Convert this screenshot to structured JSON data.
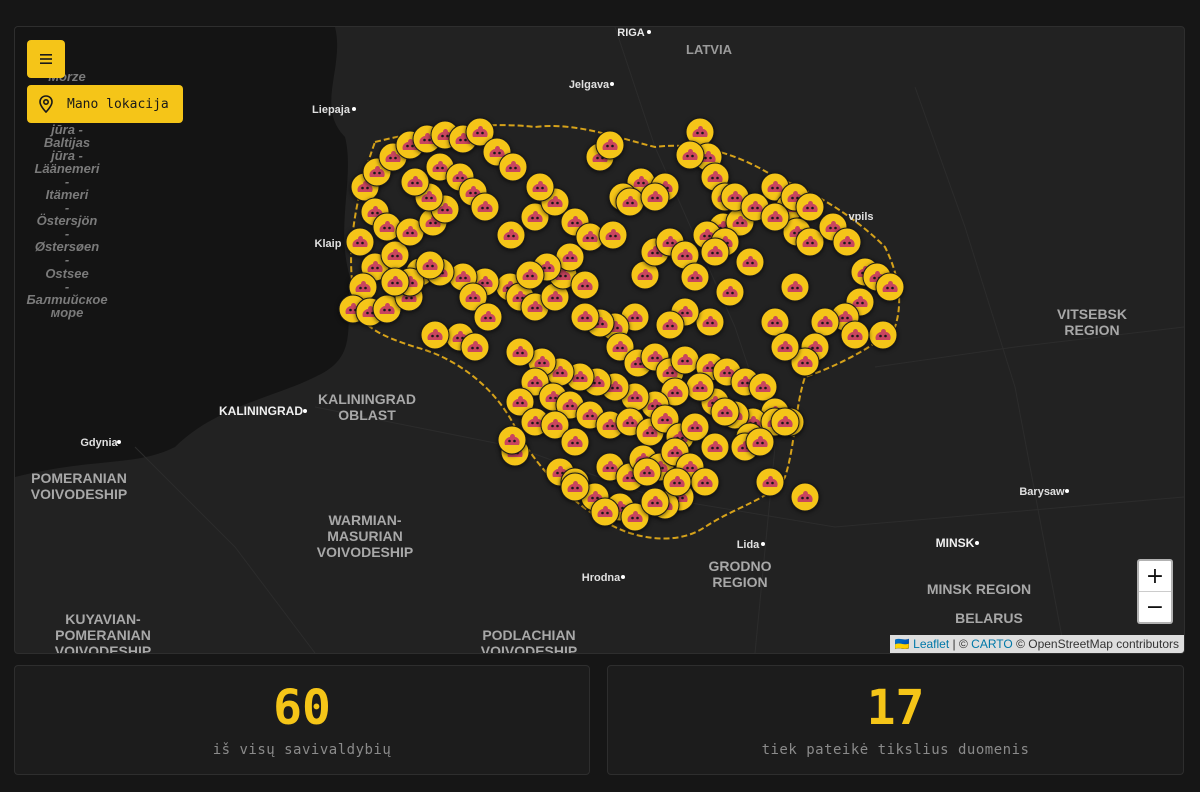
{
  "controls": {
    "menu_icon": "menu-icon",
    "location_label": "Mano lokacija",
    "location_icon": "location-pin-icon",
    "zoom_in": "+",
    "zoom_out": "−"
  },
  "attribution": {
    "flag": "🇺🇦",
    "leaflet": "Leaflet",
    "sep1": " | © ",
    "carto": "CARTO",
    "osm": " © OpenStreetMap contributors"
  },
  "map": {
    "marker_color": "#f5c518",
    "border_color": "#d6a21a",
    "labels": [
      "RIGA",
      "LATVIA",
      "Jelgava",
      "Liepaja",
      "Klaip",
      "vpils",
      "KALININGRAD",
      "KALININGRAD",
      "OBLAST",
      "Gdynia",
      "POMERANIAN",
      "VOIVODESHIP",
      "WARMIAN-",
      "MASURIAN",
      "VOIVODESHIP",
      "VITSEBSK",
      "REGION",
      "Barysaw",
      "MINSK",
      "MINSK REGION",
      "BELARUS",
      "GRODNO",
      "REGION",
      "Lida",
      "Hrodna",
      "KUYAVIAN-",
      "POMERANIAN",
      "VOIVODESHIP",
      "PODLACHIAN",
      "VOIVODESHIP",
      "Morze",
      "jūra -",
      "Baltijas",
      "jūra -",
      "Läänemeri",
      "-",
      "Itämeri",
      "-",
      "Östersjön",
      "-",
      "Østersøen",
      "-",
      "Ostsee",
      "-",
      "Балтийское",
      "море"
    ]
  },
  "stats": [
    {
      "value": "60",
      "label": "iš visų savivaldybių"
    },
    {
      "value": "17",
      "label": "tiek pateikė tikslius duomenis"
    }
  ]
}
